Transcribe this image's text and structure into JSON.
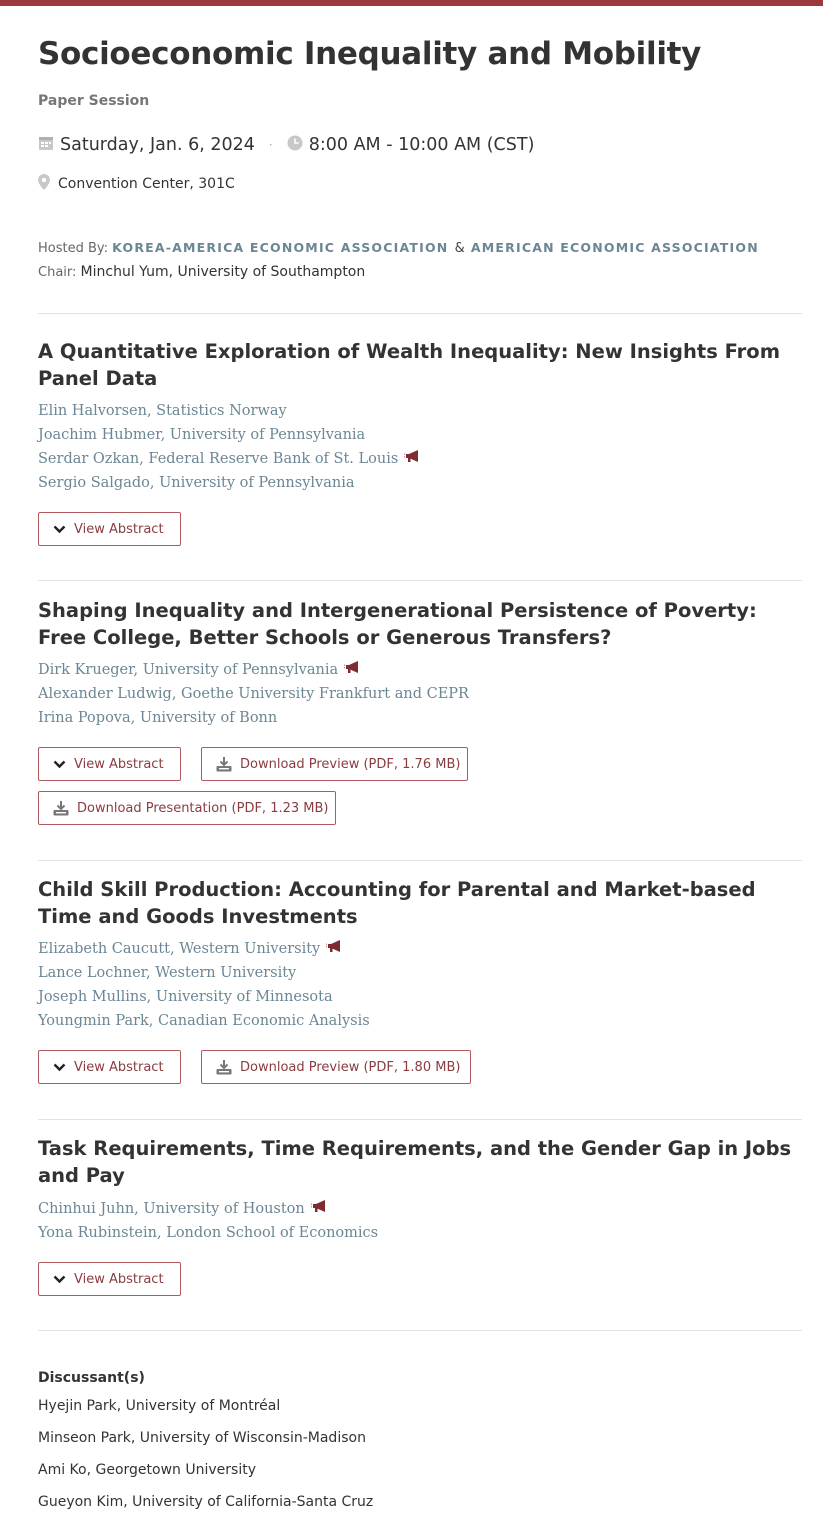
{
  "session": {
    "title": "Socioeconomic Inequality and Mobility",
    "type": "Paper Session",
    "date": "Saturday, Jan. 6, 2024",
    "time": "8:00 AM - 10:00 AM (CST)",
    "location": "Convention Center, 301C",
    "hosted_label": "Hosted By:",
    "host_1": "KOREA-AMERICA ECONOMIC ASSOCIATION",
    "host_amp": "&",
    "host_2": "AMERICAN ECONOMIC ASSOCIATION",
    "chair_label": "Chair:",
    "chair_name": "Minchul Yum, University of Southampton"
  },
  "papers": [
    {
      "title": "A Quantitative Exploration of Wealth Inequality: New Insights From Panel Data",
      "authors": [
        "Elin Halvorsen, Statistics Norway",
        "Joachim Hubmer, University of Pennsylvania",
        "Serdar Ozkan, Federal Reserve Bank of St. Louis",
        "Sergio Salgado, University of Pennsylvania"
      ],
      "view_abstract": "View Abstract"
    },
    {
      "title": "Shaping Inequality and Intergenerational Persistence of Poverty: Free College, Better Schools or Generous Transfers?",
      "authors": [
        "Dirk Krueger, University of Pennsylvania",
        "Alexander Ludwig, Goethe University Frankfurt and CEPR",
        "Irina Popova, University of Bonn"
      ],
      "view_abstract": "View Abstract",
      "download_preview": "Download Preview (PDF, 1.76 MB)",
      "download_presentation": "Download Presentation (PDF, 1.23 MB)"
    },
    {
      "title": "Child Skill Production: Accounting for Parental and Market-based Time and Goods Investments",
      "authors": [
        "Elizabeth Caucutt, Western University",
        "Lance Lochner, Western University",
        "Joseph Mullins, University of Minnesota",
        "Youngmin Park, Canadian Economic Analysis"
      ],
      "view_abstract": "View Abstract",
      "download_preview": "Download Preview (PDF, 1.80 MB)"
    },
    {
      "title": "Task Requirements, Time Requirements, and the Gender Gap in Jobs and Pay",
      "authors": [
        "Chinhui Juhn, University of Houston",
        "Yona Rubinstein, London School of Economics"
      ],
      "view_abstract": "View Abstract"
    }
  ],
  "discussants": {
    "heading": "Discussant(s)",
    "names": [
      "Hyejin Park, University of Montréal",
      "Minseon Park, University of Wisconsin-Madison",
      "Ami Ko, Georgetown University",
      "Gueyon Kim, University of California-Santa Cruz"
    ]
  },
  "icons": {
    "calendar": "calendar-icon",
    "clock": "clock-icon",
    "location": "map-pin-icon",
    "presenter": "megaphone-icon",
    "expand": "chevron-down-icon",
    "download": "download-icon"
  },
  "colors": {
    "accent_bar": "#9b3a3e",
    "button_text": "#8a3c40",
    "author_link": "#6b8694"
  }
}
